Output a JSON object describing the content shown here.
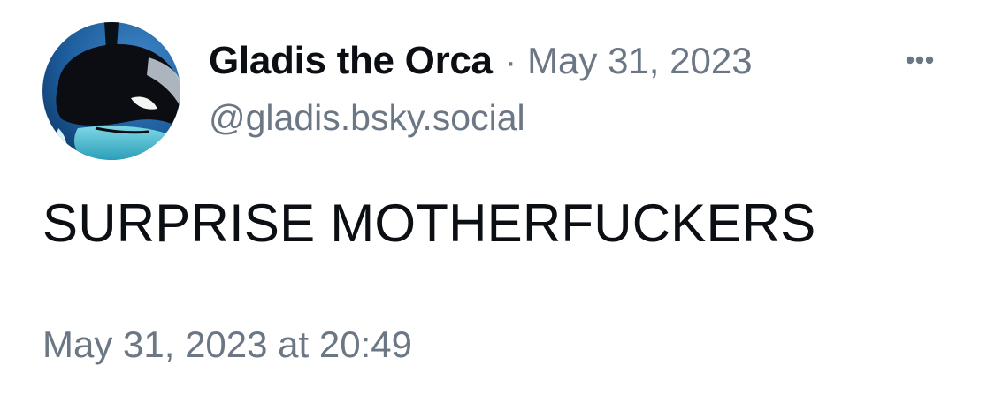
{
  "post": {
    "author": {
      "display_name": "Gladis the Orca",
      "handle": "@gladis.bsky.social",
      "avatar_icon": "orca-avatar"
    },
    "separator": "·",
    "date_short": "May 31, 2023",
    "more_icon": "ellipsis-icon",
    "text": "SURPRISE MOTHERFUCKERS",
    "timestamp_full": "May 31, 2023 at 20:49"
  },
  "colors": {
    "text_primary": "#0b0f14",
    "text_secondary": "#6b7785",
    "background": "#ffffff"
  }
}
